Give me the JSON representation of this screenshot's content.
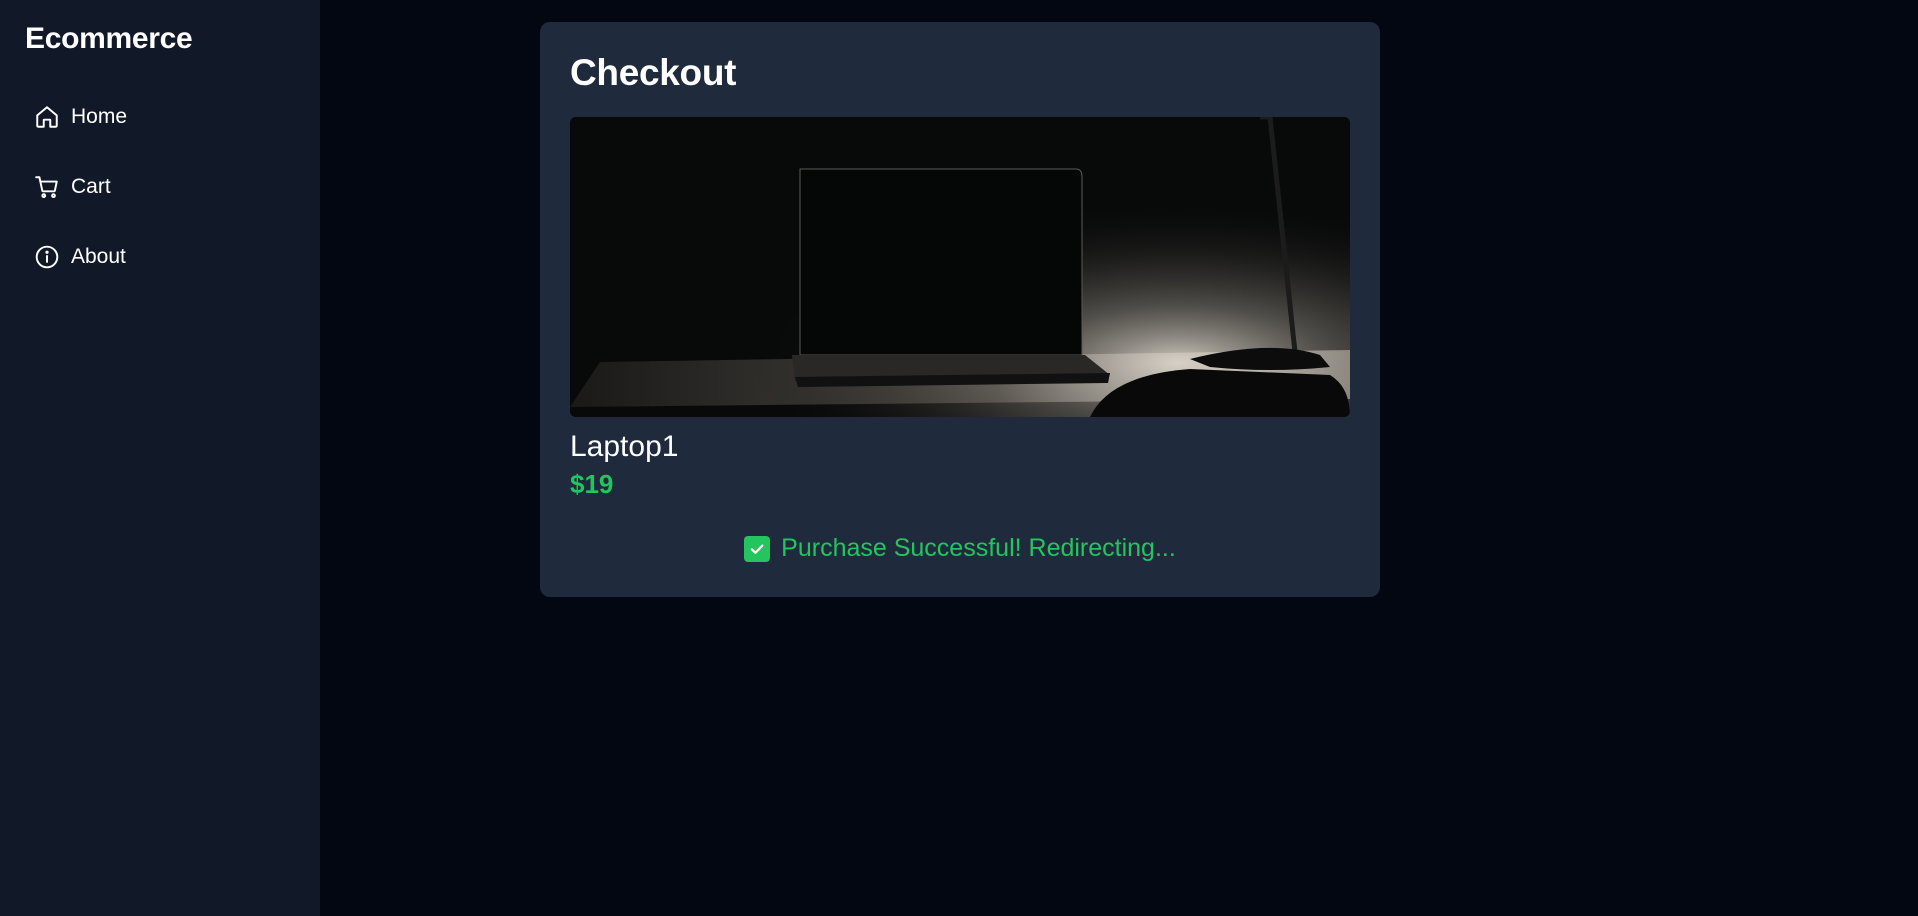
{
  "app": {
    "brand": "Ecommerce"
  },
  "sidebar": {
    "items": [
      {
        "label": "Home",
        "icon": "home-icon"
      },
      {
        "label": "Cart",
        "icon": "cart-icon"
      },
      {
        "label": "About",
        "icon": "info-icon"
      }
    ]
  },
  "checkout": {
    "title": "Checkout",
    "product": {
      "name": "Laptop1",
      "price": "$19",
      "image": "laptop-on-desk-photo"
    },
    "status": {
      "text": "Purchase Successful! Redirecting...",
      "icon": "checkbox-checked-icon"
    }
  },
  "colors": {
    "page_background": "#020712",
    "sidebar_background": "#111827",
    "card_background": "#1f2a3c",
    "success": "#22c55e",
    "text": "#ffffff"
  }
}
